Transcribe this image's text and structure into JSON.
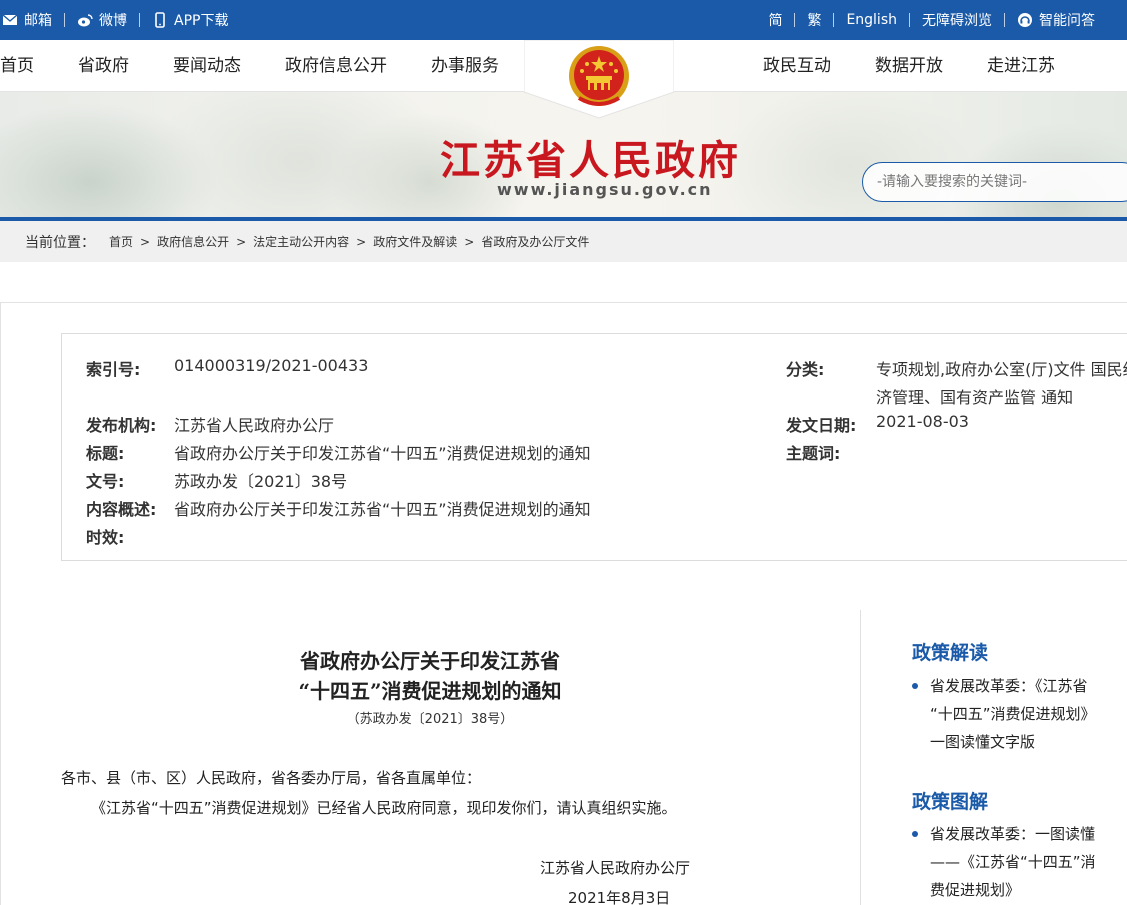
{
  "topbar": {
    "left": [
      {
        "label": "邮箱",
        "icon": "mail-icon"
      },
      {
        "label": "微博",
        "icon": "weibo-icon"
      },
      {
        "label": "APP下载",
        "icon": "phone-icon"
      }
    ],
    "right": [
      {
        "label": "简"
      },
      {
        "label": "繁"
      },
      {
        "label": "English"
      },
      {
        "label": "无障碍浏览"
      },
      {
        "label": "智能问答",
        "icon": "headset-icon"
      }
    ]
  },
  "nav": {
    "left": [
      "首页",
      "省政府",
      "要闻动态",
      "政府信息公开",
      "办事服务"
    ],
    "right": [
      "政民互动",
      "数据开放",
      "走进江苏"
    ]
  },
  "banner": {
    "title": "江苏省人民政府",
    "url": "www.jiangsu.gov.cn",
    "search_placeholder": "-请输入要搜索的关键词-"
  },
  "breadcrumb": {
    "label": "当前位置：",
    "items": [
      "首页",
      "政府信息公开",
      "法定主动公开内容",
      "政府文件及解读",
      "省政府及办公厅文件"
    ]
  },
  "meta": {
    "index_label": "索引号:",
    "index_value": "014000319/2021-00433",
    "category_label": "分类:",
    "category_value_1": "专项规划,政府办公室(厅)文件 国民经",
    "category_value_2": "济管理、国有资产监管 通知",
    "issuer_label": "发布机构:",
    "issuer_value": "江苏省人民政府办公厅",
    "date_label": "发文日期:",
    "date_value": "2021-08-03",
    "title_label": "标题:",
    "title_value": "省政府办公厅关于印发江苏省“十四五”消费促进规划的通知",
    "subject_label": "主题词:",
    "docno_label": "文号:",
    "docno_value": "苏政办发〔2021〕38号",
    "summary_label": "内容概述:",
    "summary_value": "省政府办公厅关于印发江苏省“十四五”消费促进规划的通知",
    "validity_label": "时效:"
  },
  "article": {
    "title_1": "省政府办公厅关于印发江苏省",
    "title_2": "“十四五”消费促进规划的通知",
    "docno": "（苏政办发〔2021〕38号）",
    "salutation": "各市、县（市、区）人民政府，省各委办厅局，省各直属单位：",
    "body": "《江苏省“十四五”消费促进规划》已经省人民政府同意，现印发你们，请认真组织实施。",
    "signature": "江苏省人民政府办公厅",
    "date": "2021年8月3日"
  },
  "sidebar": {
    "interpretation_title": "政策解读",
    "interpretation_item": [
      "省发展改革委：《江苏省",
      "“十四五”消费促进规划》",
      "一图读懂文字版"
    ],
    "graphic_title": "政策图解",
    "graphic_item": [
      "省发展改革委：一图读懂",
      "——《江苏省“十四五”消",
      "费促进规划》"
    ]
  },
  "colors": {
    "primary": "#1a5aa8",
    "title_red": "#c8171e"
  }
}
